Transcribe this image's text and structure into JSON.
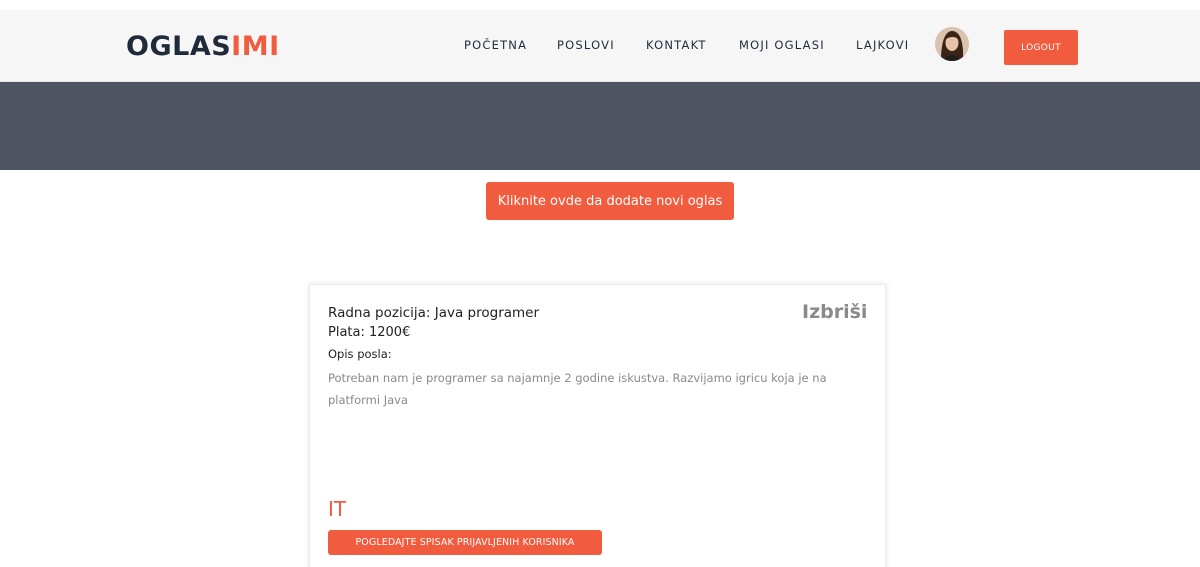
{
  "header": {
    "logo_part1": "OGLAS",
    "logo_part2": "IMI",
    "nav": [
      {
        "label": "POČETNA"
      },
      {
        "label": "POSLOVI"
      },
      {
        "label": "KONTAKT"
      },
      {
        "label": "MOJI OGLASI"
      },
      {
        "label": "LAJKOVI"
      }
    ],
    "logout_label": "LOGOUT"
  },
  "main": {
    "add_button_label": "Kliknite ovde da dodate novi oglas"
  },
  "listing": {
    "position": "Radna pozicija: Java programer",
    "salary": "Plata: 1200€",
    "description_label": "Opis posla:",
    "description": "Potreban nam je programer sa najamnje 2 godine iskustva. Razvijamo igricu koja je na platformi Java",
    "delete_label": "Izbriši",
    "category": "IT",
    "applicants_button_label": "POGLEDAJTE SPISAK PRIJAVLJENIH KORISNIKA"
  },
  "colors": {
    "accent": "#f15b3e",
    "dark": "#1f2a3a",
    "hero": "#4f5560"
  },
  "icons": {
    "avatar": "user-avatar"
  }
}
